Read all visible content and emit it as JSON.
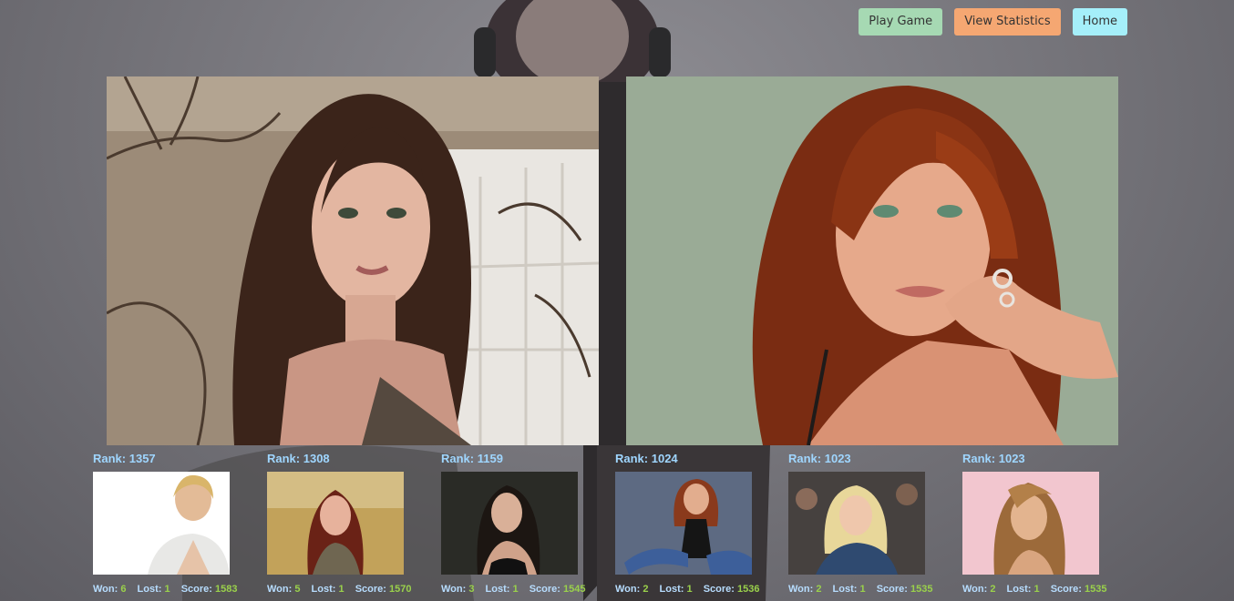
{
  "nav": {
    "play_label": "Play Game",
    "stats_label": "View Statistics",
    "home_label": "Home"
  },
  "colors": {
    "play": "#a6d9b3",
    "stats": "#f5a772",
    "home": "#a5effa",
    "rank_text": "#9fd6ff",
    "value_text": "#9ad14b"
  },
  "labels": {
    "won": "Won:",
    "lost": "Lost:",
    "score": "Score:"
  },
  "leaderboard": [
    {
      "rank": "Rank: 1357",
      "won": "6",
      "lost": "1",
      "score": "1583"
    },
    {
      "rank": "Rank: 1308",
      "won": "5",
      "lost": "1",
      "score": "1570"
    },
    {
      "rank": "Rank: 1159",
      "won": "3",
      "lost": "1",
      "score": "1545"
    },
    {
      "rank": "Rank: 1024",
      "won": "2",
      "lost": "1",
      "score": "1536"
    },
    {
      "rank": "Rank: 1023",
      "won": "2",
      "lost": "1",
      "score": "1535"
    },
    {
      "rank": "Rank: 1023",
      "won": "2",
      "lost": "1",
      "score": "1535"
    }
  ]
}
